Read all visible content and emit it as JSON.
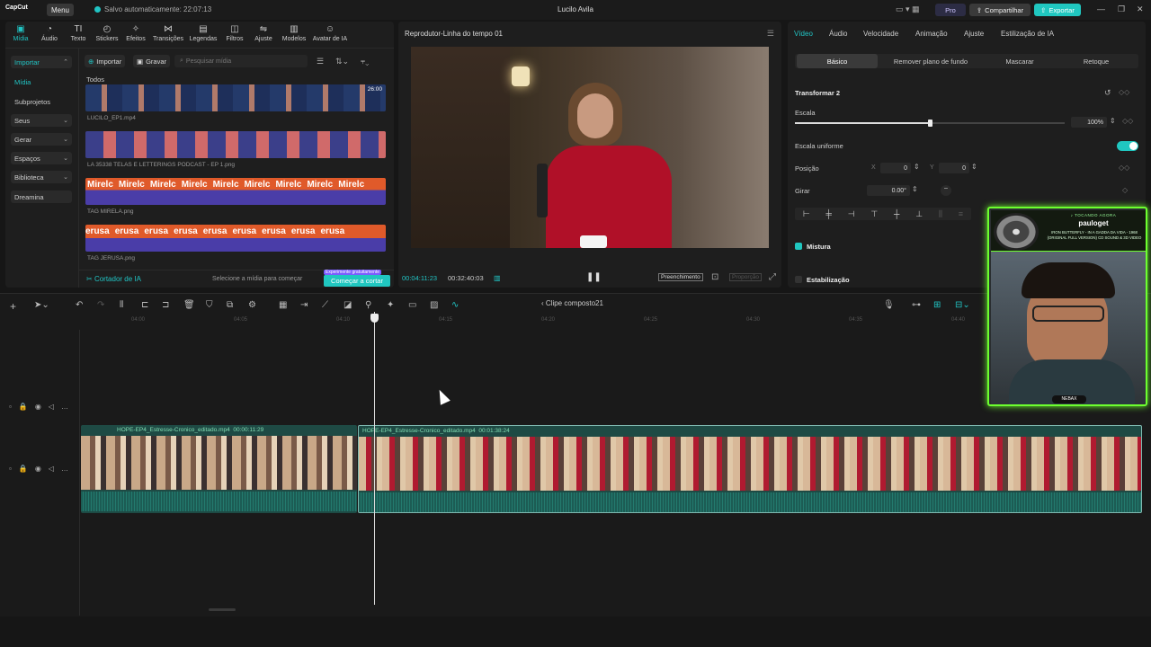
{
  "app": {
    "logo": "CapCut",
    "menu": "Menu",
    "autosave": "Salvo automaticamente: 22:07:13",
    "title": "Lucilo Avila",
    "pro": "Pro",
    "share": "Compartilhar",
    "export": "Exportar"
  },
  "toolbar": [
    "Mídia",
    "Áudio",
    "Texto",
    "Stickers",
    "Efeitos",
    "Transições",
    "Legendas",
    "Filtros",
    "Ajuste",
    "Modelos",
    "Avatar de IA"
  ],
  "sidebar": {
    "import": "Importar",
    "items": [
      "Mídia",
      "Subprojetos",
      "Seus",
      "Gerar",
      "Espaços",
      "Biblioteca",
      "Dreamina"
    ]
  },
  "media": {
    "import_btn": "Importar",
    "record_btn": "Gravar",
    "search_placeholder": "Pesquisar mídia",
    "section": "Todos",
    "clips": [
      {
        "name": "LUCILO_EP1.mp4",
        "duration": "26:00"
      },
      {
        "name": "LA 35338 TELAS E LETTERINGS PODCAST - EP 1.png"
      },
      {
        "name": "TAG MIRELA.png",
        "text": "Mirelc"
      },
      {
        "name": "TAG JERUSA.png",
        "text": "erusa"
      }
    ],
    "ai_cutter": "Cortador de IA",
    "ai_hint": "Selecione a mídia para começar",
    "ai_badge": "Experimente gratuitamente",
    "ai_start": "Começar a cortar"
  },
  "player": {
    "title": "Reprodutor-Linha do tempo 01",
    "current": "00:04:11:23",
    "total": "00:32:40:03",
    "fill": "Preenchimento",
    "ratio": "Proporção"
  },
  "props": {
    "tabs": [
      "Vídeo",
      "Áudio",
      "Velocidade",
      "Animação",
      "Ajuste",
      "Estilização de IA"
    ],
    "subtabs": [
      "Básico",
      "Remover plano de fundo",
      "Mascarar",
      "Retoque"
    ],
    "transform": "Transformar 2",
    "scale_label": "Escala",
    "scale_value": "100%",
    "scale_fraction": 0.5,
    "uniform": "Escala uniforme",
    "pos_label": "Posição",
    "pos_x_label": "X",
    "pos_x": "0",
    "pos_y_label": "Y",
    "pos_y": "0",
    "rotate_label": "Girar",
    "rotate_value": "0.00°",
    "blend": "Mistura",
    "stabilize": "Estabilização"
  },
  "timeline": {
    "compound": "Clipe composto21",
    "ticks": [
      "04:00",
      "04:05",
      "04:10",
      "04:15",
      "04:20",
      "04:25",
      "04:30",
      "04:35",
      "04:40"
    ],
    "clipA": {
      "name": "HOPE-EP4_Estresse-Cronico_editado.mp4",
      "dur": "00:00:11:29"
    },
    "clipB": {
      "name": "HOPE-EP4_Estresse-Cronico_editado.mp4",
      "dur": "00:01:38:24"
    }
  },
  "cam": {
    "now": "♪ TOCANDO AGORA",
    "user": "pauloget",
    "song": "IRON BUTTERFLY - IN A GADDA DA VIDA - 1968 (ORIGINAL FULL VERSION) CD SOUND & 3D VIDEO",
    "brand": "NEBAX"
  }
}
